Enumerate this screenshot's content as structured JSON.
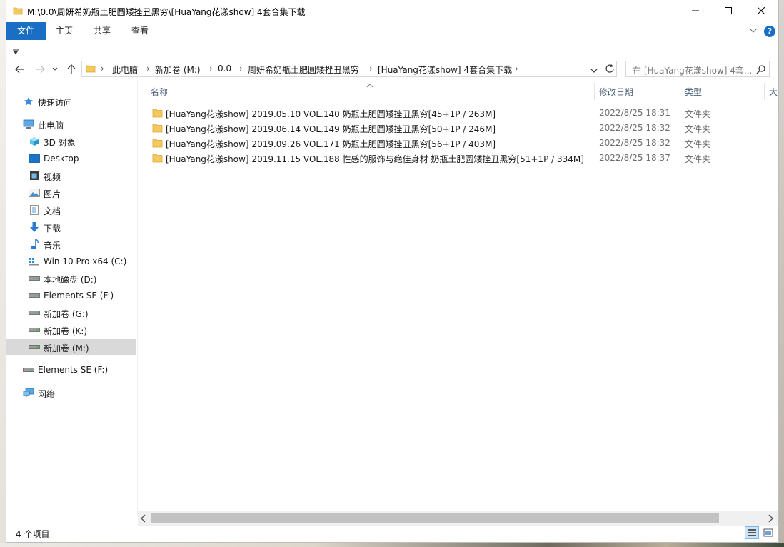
{
  "window": {
    "title": "M:\\0.0\\周妍希奶瓶土肥圆矮挫丑黑穷\\[HuaYang花漾show] 4套合集下载"
  },
  "ribbon": {
    "tabs": [
      "文件",
      "主页",
      "共享",
      "查看"
    ]
  },
  "address": {
    "crumbs": [
      "此电脑",
      "新加卷 (M:)",
      "0.0",
      "周妍希奶瓶土肥圆矮挫丑黑穷",
      "[HuaYang花漾show] 4套合集下载"
    ]
  },
  "search": {
    "placeholder": "在 [HuaYang花漾show] 4套..."
  },
  "nav": {
    "items": [
      {
        "label": "快速访问",
        "icon": "star-icon"
      },
      {
        "label": "此电脑",
        "icon": "computer-icon"
      },
      {
        "label": "3D 对象",
        "icon": "cube-icon"
      },
      {
        "label": "Desktop",
        "icon": "desktop-icon"
      },
      {
        "label": "视频",
        "icon": "video-icon"
      },
      {
        "label": "图片",
        "icon": "picture-icon"
      },
      {
        "label": "文档",
        "icon": "document-icon"
      },
      {
        "label": "下载",
        "icon": "download-arrow-icon"
      },
      {
        "label": "音乐",
        "icon": "music-note-icon"
      },
      {
        "label": "Win 10 Pro x64 (C:)",
        "icon": "windows-drive-icon"
      },
      {
        "label": "本地磁盘 (D:)",
        "icon": "drive-icon"
      },
      {
        "label": "Elements SE (F:)",
        "icon": "drive-icon"
      },
      {
        "label": "新加卷 (G:)",
        "icon": "drive-icon"
      },
      {
        "label": "新加卷 (K:)",
        "icon": "drive-icon"
      },
      {
        "label": "新加卷 (M:)",
        "icon": "drive-icon"
      },
      {
        "label": "Elements SE (F:)",
        "icon": "drive-icon"
      },
      {
        "label": "网络",
        "icon": "network-icon"
      }
    ]
  },
  "columns": {
    "name": "名称",
    "date": "修改日期",
    "type": "类型",
    "size": "大"
  },
  "files": [
    {
      "name": "[HuaYang花漾show] 2019.05.10 VOL.140 奶瓶土肥圆矮挫丑黑穷[45+1P / 263M]",
      "date": "2022/8/25 18:31",
      "type": "文件夹"
    },
    {
      "name": "[HuaYang花漾show] 2019.06.14 VOL.149 奶瓶土肥圆矮挫丑黑穷[50+1P / 246M]",
      "date": "2022/8/25 18:32",
      "type": "文件夹"
    },
    {
      "name": "[HuaYang花漾show] 2019.09.26 VOL.171 奶瓶土肥圆矮挫丑黑穷[56+1P / 403M]",
      "date": "2022/8/25 18:32",
      "type": "文件夹"
    },
    {
      "name": "[HuaYang花漾show] 2019.11.15 VOL.188 性感的服饰与绝佳身材 奶瓶土肥圆矮挫丑黑穷[51+1P / 334M]",
      "date": "2022/8/25 18:37",
      "type": "文件夹"
    }
  ],
  "status": {
    "count": "4 个项目"
  },
  "colors": {
    "accent": "#1a6fc4",
    "folder": "#f4c95d"
  }
}
